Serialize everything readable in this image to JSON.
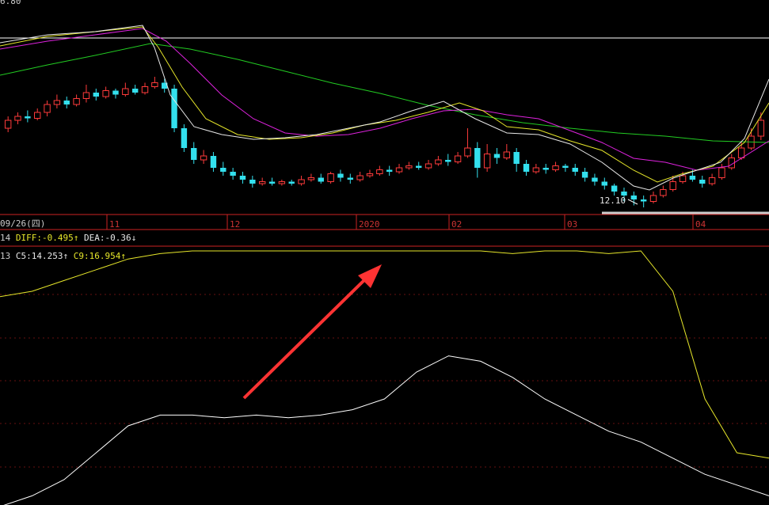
{
  "colors": {
    "up": "#ff3b3b",
    "down": "#33e0ee",
    "ma_white": "#e8e8e8",
    "ma_yellow": "#e6e62a",
    "ma_magenta": "#dd22dd",
    "ma_green": "#22cc22",
    "axis_red": "#cc2222",
    "grid": "#661111",
    "label_yellow": "#e6e62a",
    "arrow": "#ff3333"
  },
  "price_panel": {
    "top_value_label": "6.80",
    "low_annotation": "12.10"
  },
  "date_axis": {
    "first_label": "09/26(四)",
    "ticks": [
      "11",
      "12",
      "2020",
      "02",
      "03",
      "04"
    ]
  },
  "macd_row": {
    "prefix": "14",
    "diff_label": "DIFF:-0.495",
    "diff_arrow": "↑",
    "dea_label": "DEA:-0.36",
    "dea_arrow": "↓"
  },
  "indicator_row": {
    "prefix": "13",
    "c5_label": "C5:14.253",
    "c5_arrow": "↑",
    "c9_label": "C9:16.954",
    "c9_arrow": "↑"
  },
  "chart_data": [
    {
      "type": "candlestick",
      "title": "",
      "note": "relative price levels (0 = low of panel, 100 = high of panel)",
      "candles": [
        [
          40,
          44,
          38,
          46
        ],
        [
          44,
          46,
          42,
          48
        ],
        [
          46,
          45,
          43,
          49
        ],
        [
          45,
          48,
          44,
          50
        ],
        [
          48,
          52,
          46,
          54
        ],
        [
          52,
          54,
          50,
          57
        ],
        [
          54,
          52,
          50,
          56
        ],
        [
          52,
          55,
          51,
          57
        ],
        [
          55,
          58,
          53,
          62
        ],
        [
          58,
          56,
          54,
          60
        ],
        [
          56,
          59,
          55,
          61
        ],
        [
          59,
          57,
          55,
          60
        ],
        [
          57,
          60,
          56,
          63
        ],
        [
          60,
          58,
          57,
          62
        ],
        [
          58,
          61,
          57,
          63
        ],
        [
          61,
          63,
          60,
          66
        ],
        [
          63,
          60,
          58,
          65
        ],
        [
          60,
          40,
          38,
          62
        ],
        [
          40,
          30,
          28,
          42
        ],
        [
          30,
          24,
          22,
          33
        ],
        [
          24,
          26,
          22,
          29
        ],
        [
          26,
          20,
          18,
          28
        ],
        [
          20,
          18,
          16,
          23
        ],
        [
          18,
          16,
          14,
          20
        ],
        [
          16,
          14,
          12,
          18
        ],
        [
          14,
          12,
          10,
          16
        ],
        [
          12,
          13,
          11,
          15
        ],
        [
          13,
          12,
          11,
          15
        ],
        [
          12,
          13,
          11,
          14
        ],
        [
          13,
          12,
          11,
          14
        ],
        [
          12,
          14,
          11,
          16
        ],
        [
          14,
          15,
          13,
          17
        ],
        [
          15,
          13,
          12,
          17
        ],
        [
          13,
          17,
          12,
          18
        ],
        [
          17,
          15,
          13,
          19
        ],
        [
          15,
          14,
          12,
          17
        ],
        [
          14,
          16,
          13,
          18
        ],
        [
          16,
          17,
          15,
          19
        ],
        [
          17,
          19,
          16,
          21
        ],
        [
          19,
          18,
          16,
          21
        ],
        [
          18,
          20,
          17,
          22
        ],
        [
          20,
          21,
          19,
          23
        ],
        [
          21,
          20,
          19,
          23
        ],
        [
          20,
          22,
          19,
          24
        ],
        [
          22,
          24,
          21,
          26
        ],
        [
          24,
          23,
          21,
          27
        ],
        [
          23,
          26,
          22,
          28
        ],
        [
          26,
          30,
          25,
          40
        ],
        [
          30,
          20,
          15,
          33
        ],
        [
          20,
          27,
          18,
          32
        ],
        [
          27,
          25,
          22,
          30
        ],
        [
          25,
          28,
          24,
          32
        ],
        [
          28,
          22,
          18,
          30
        ],
        [
          22,
          18,
          16,
          24
        ],
        [
          18,
          20,
          17,
          22
        ],
        [
          20,
          19,
          17,
          22
        ],
        [
          19,
          21,
          18,
          23
        ],
        [
          21,
          20,
          18,
          22
        ],
        [
          20,
          18,
          16,
          22
        ],
        [
          18,
          15,
          13,
          20
        ],
        [
          15,
          13,
          11,
          17
        ],
        [
          13,
          11,
          9,
          15
        ],
        [
          11,
          8,
          6,
          12
        ],
        [
          8,
          6,
          3,
          10
        ],
        [
          6,
          4,
          1,
          8
        ],
        [
          4,
          3,
          0,
          6
        ],
        [
          3,
          6,
          2,
          8
        ],
        [
          6,
          9,
          5,
          11
        ],
        [
          9,
          13,
          8,
          16
        ],
        [
          13,
          16,
          12,
          18
        ],
        [
          16,
          14,
          13,
          19
        ],
        [
          14,
          12,
          10,
          16
        ],
        [
          12,
          15,
          11,
          17
        ],
        [
          15,
          20,
          14,
          22
        ],
        [
          20,
          25,
          19,
          27
        ],
        [
          25,
          30,
          24,
          33
        ],
        [
          30,
          36,
          29,
          40
        ],
        [
          36,
          44,
          34,
          48
        ]
      ]
    },
    {
      "type": "line",
      "title": "",
      "series": [
        {
          "name": "C5",
          "values": [
            78,
            80,
            84,
            88,
            92,
            94,
            95,
            95,
            95,
            95,
            95,
            95,
            95,
            95,
            95,
            95,
            94,
            95,
            95,
            94,
            95,
            80,
            40,
            20,
            18
          ]
        },
        {
          "name": "C9",
          "values": [
            0,
            4,
            10,
            20,
            30,
            34,
            34,
            33,
            34,
            33,
            34,
            36,
            40,
            50,
            56,
            54,
            48,
            40,
            34,
            28,
            24,
            18,
            12,
            8,
            4
          ]
        }
      ]
    }
  ]
}
